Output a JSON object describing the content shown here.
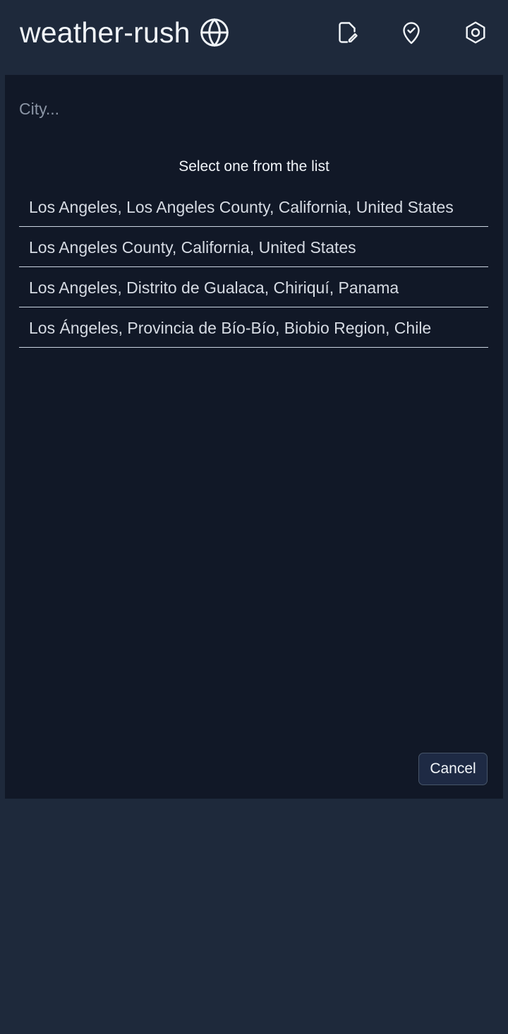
{
  "header": {
    "title": "weather-rush",
    "brand_icon": "globe-icon",
    "actions": [
      {
        "icon": "edit-document-icon"
      },
      {
        "icon": "location-check-icon"
      },
      {
        "icon": "settings-gear-icon"
      }
    ]
  },
  "search": {
    "value": "",
    "placeholder": "City..."
  },
  "results": {
    "heading": "Select one from the list",
    "items": [
      {
        "label": "Los Angeles, Los Angeles County, California, United States"
      },
      {
        "label": "Los Angeles County, California, United States"
      },
      {
        "label": "Los Angeles, Distrito de Gualaca, Chiriquí, Panama"
      },
      {
        "label": "Los Ángeles, Provincia de Bío-Bío, Biobio Region, Chile"
      }
    ]
  },
  "footer": {
    "cancel_label": "Cancel"
  },
  "colors": {
    "background": "#1e293b",
    "panel": "#111827",
    "text": "#e2e8f0",
    "divider": "#cbd5e1"
  }
}
